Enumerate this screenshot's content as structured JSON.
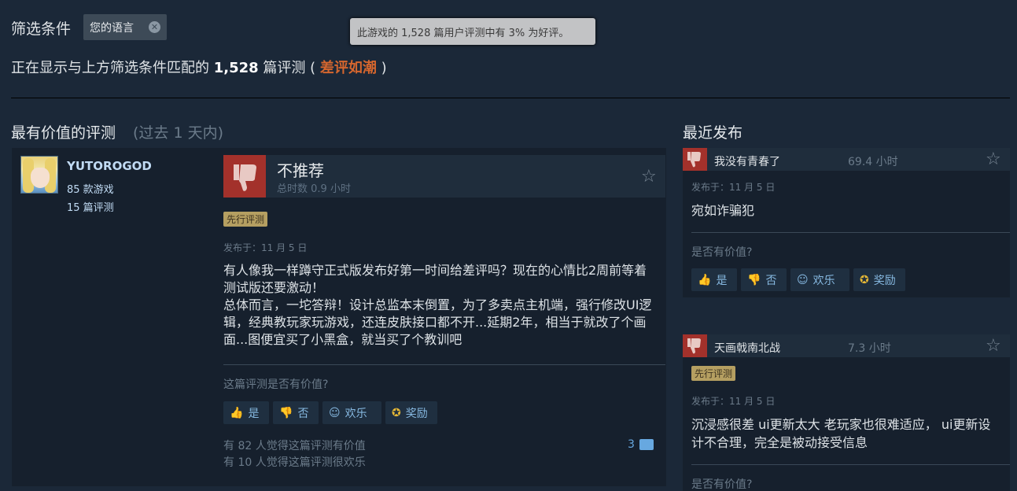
{
  "filter": {
    "label": "筛选条件",
    "language_chip": "您的语言"
  },
  "tooltip": "此游戏的 1,528 篇用户评测中有 3% 为好评。",
  "summary": {
    "prefix": "正在显示与上方筛选条件匹配的",
    "count": "1,528",
    "unit": "篇评测 (",
    "rating": "差评如潮",
    "suffix": ")"
  },
  "sections": {
    "helpful_title": "最有价值的评测",
    "helpful_range": "(过去  1  天内)",
    "recent_title": "最近发布"
  },
  "main_review": {
    "user": {
      "name": "YUTOROGOD",
      "games": "85 款游戏",
      "reviews": "15 篇评测"
    },
    "verdict": "不推荐",
    "hours": "总时数 0.9 小时",
    "badge": "先行评测",
    "posted": "发布于：11 月 5 日",
    "text": "有人像我一样蹲守正式版发布好第一时间给差评吗？现在的心情比2周前等着测试版还要激动！\n总体而言，一坨答辩！设计总监本末倒置，为了多卖点主机端，强行修改UI逻辑，经典教玩家玩游戏，还连皮肤接口都不开...延期2年，相当于就改了个画面...图便宜买了小黑盒，就当买了个教训吧",
    "helpful_question": "这篇评测是否有价值?",
    "buttons": {
      "yes": "是",
      "no": "否",
      "funny": "欢乐",
      "award": "奖励"
    },
    "stat_helpful": "有 82 人觉得这篇评测有价值",
    "stat_funny": "有 10 人觉得这篇评测很欢乐",
    "comment_count": "3"
  },
  "recent": [
    {
      "name": "我没有青春了",
      "time": "69.4 小时",
      "posted": "发布于：11 月 5 日",
      "text": "宛如诈骗犯",
      "helpful_question": "是否有价值?",
      "buttons": {
        "yes": "是",
        "no": "否",
        "funny": "欢乐",
        "award": "奖励"
      }
    },
    {
      "name": "天画戟南北战",
      "time": "7.3 小时",
      "badge": "先行评测",
      "posted": "发布于：11 月 5 日",
      "text": "沉浸感很差 ui更新太大 老玩家也很难适应， ui更新设计不合理，完全是被动接受信息",
      "helpful_question": "是否有价值?"
    }
  ],
  "colors": {
    "background": "#1b2838",
    "negative": "#d5662e",
    "thumb_down": "#a3312b",
    "badge": "#b59f61"
  },
  "icons": [
    "close-icon",
    "thumbs-down-icon",
    "star-icon",
    "thumbs-up-icon",
    "smiley-icon",
    "award-icon",
    "comment-icon"
  ]
}
